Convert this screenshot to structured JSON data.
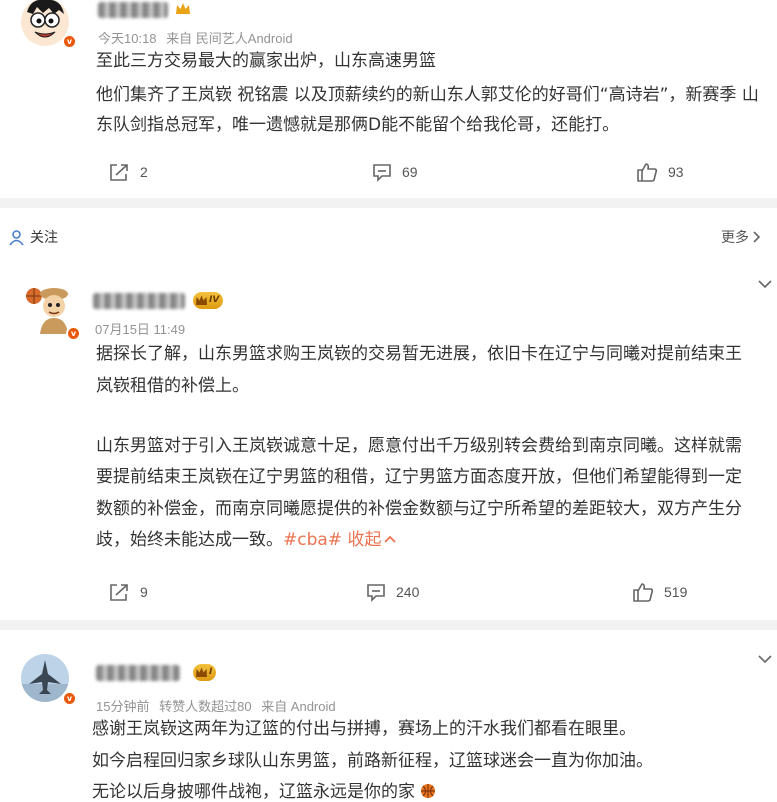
{
  "posts": [
    {
      "time": "今天10:18",
      "source": "来自 民间艺人Android",
      "lines": [
        "至此三方交易最大的赢家出炉，山东高速男篮",
        "他们集齐了王岚嵚 祝铭震 以及顶薪续约的新山东人郭艾伦的好哥们“高诗岩”，新赛季 山",
        "东队剑指总冠军，唯一遗憾就是那俩D能不能留个给我伦哥，还能打。"
      ],
      "actions": {
        "repost": "2",
        "comment": "69",
        "like": "93"
      }
    },
    {
      "time": "07月15日 11:49",
      "level": "IV",
      "lines": [
        "据探长了解，山东男篮求购王岚嵚的交易暂无进展，依旧卡在辽宁与同曦对提前结束王",
        "岚嵚租借的补偿上。",
        "山东男篮对于引入王岚嵚诚意十足，愿意付出千万级别转会费给到南京同曦。这样就需",
        "要提前结束王岚嵚在辽宁男篮的租借，辽宁男篮方面态度开放，但他们希望能得到一定",
        "数额的补偿金，而南京同曦愿提供的补偿金数额与辽宁所希望的差距较大，双方产生分",
        "歧，始终未能达成一致。"
      ],
      "hashtag": "#cba#",
      "collapse": "收起",
      "actions": {
        "repost": "9",
        "comment": "240",
        "like": "519"
      }
    },
    {
      "time": "15分钟前",
      "likers": "转赞人数超过80",
      "source": "来自 Android",
      "level": "I",
      "lines": [
        "感谢王岚嵚这两年为辽篮的付出与拼搏，赛场上的汗水我们都看在眼里。",
        "如今启程回归家乡球队山东男篮，前路新征程，辽篮球迷会一直为你加油。",
        "无论以后身披哪件战袍，辽篮永远是你的家"
      ]
    }
  ],
  "follow_bar": {
    "follow_label": "关注",
    "more_label": "更多"
  },
  "icons": {
    "repost": "repost-icon",
    "comment": "comment-icon",
    "like": "thumbs-up-icon",
    "more": "chevron-down-icon",
    "follow": "person-icon",
    "basketball": "basketball-emoji"
  },
  "colors": {
    "accent": "#eb7350",
    "badge": "#e8590c",
    "level_gold": "#f4c23d",
    "divider": "#f2f2f2"
  }
}
